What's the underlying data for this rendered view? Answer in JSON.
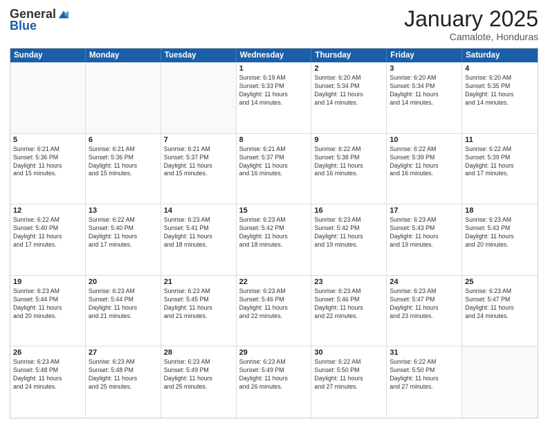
{
  "logo": {
    "general": "General",
    "blue": "Blue"
  },
  "title": "January 2025",
  "location": "Camalote, Honduras",
  "weekdays": [
    "Sunday",
    "Monday",
    "Tuesday",
    "Wednesday",
    "Thursday",
    "Friday",
    "Saturday"
  ],
  "weeks": [
    [
      {
        "day": "",
        "info": ""
      },
      {
        "day": "",
        "info": ""
      },
      {
        "day": "",
        "info": ""
      },
      {
        "day": "1",
        "info": "Sunrise: 6:19 AM\nSunset: 5:33 PM\nDaylight: 11 hours\nand 14 minutes."
      },
      {
        "day": "2",
        "info": "Sunrise: 6:20 AM\nSunset: 5:34 PM\nDaylight: 11 hours\nand 14 minutes."
      },
      {
        "day": "3",
        "info": "Sunrise: 6:20 AM\nSunset: 5:34 PM\nDaylight: 11 hours\nand 14 minutes."
      },
      {
        "day": "4",
        "info": "Sunrise: 6:20 AM\nSunset: 5:35 PM\nDaylight: 11 hours\nand 14 minutes."
      }
    ],
    [
      {
        "day": "5",
        "info": "Sunrise: 6:21 AM\nSunset: 5:36 PM\nDaylight: 11 hours\nand 15 minutes."
      },
      {
        "day": "6",
        "info": "Sunrise: 6:21 AM\nSunset: 5:36 PM\nDaylight: 11 hours\nand 15 minutes."
      },
      {
        "day": "7",
        "info": "Sunrise: 6:21 AM\nSunset: 5:37 PM\nDaylight: 11 hours\nand 15 minutes."
      },
      {
        "day": "8",
        "info": "Sunrise: 6:21 AM\nSunset: 5:37 PM\nDaylight: 11 hours\nand 16 minutes."
      },
      {
        "day": "9",
        "info": "Sunrise: 6:22 AM\nSunset: 5:38 PM\nDaylight: 11 hours\nand 16 minutes."
      },
      {
        "day": "10",
        "info": "Sunrise: 6:22 AM\nSunset: 5:39 PM\nDaylight: 11 hours\nand 16 minutes."
      },
      {
        "day": "11",
        "info": "Sunrise: 6:22 AM\nSunset: 5:39 PM\nDaylight: 11 hours\nand 17 minutes."
      }
    ],
    [
      {
        "day": "12",
        "info": "Sunrise: 6:22 AM\nSunset: 5:40 PM\nDaylight: 11 hours\nand 17 minutes."
      },
      {
        "day": "13",
        "info": "Sunrise: 6:22 AM\nSunset: 5:40 PM\nDaylight: 11 hours\nand 17 minutes."
      },
      {
        "day": "14",
        "info": "Sunrise: 6:23 AM\nSunset: 5:41 PM\nDaylight: 11 hours\nand 18 minutes."
      },
      {
        "day": "15",
        "info": "Sunrise: 6:23 AM\nSunset: 5:42 PM\nDaylight: 11 hours\nand 18 minutes."
      },
      {
        "day": "16",
        "info": "Sunrise: 6:23 AM\nSunset: 5:42 PM\nDaylight: 11 hours\nand 19 minutes."
      },
      {
        "day": "17",
        "info": "Sunrise: 6:23 AM\nSunset: 5:43 PM\nDaylight: 11 hours\nand 19 minutes."
      },
      {
        "day": "18",
        "info": "Sunrise: 6:23 AM\nSunset: 5:43 PM\nDaylight: 11 hours\nand 20 minutes."
      }
    ],
    [
      {
        "day": "19",
        "info": "Sunrise: 6:23 AM\nSunset: 5:44 PM\nDaylight: 11 hours\nand 20 minutes."
      },
      {
        "day": "20",
        "info": "Sunrise: 6:23 AM\nSunset: 5:44 PM\nDaylight: 11 hours\nand 21 minutes."
      },
      {
        "day": "21",
        "info": "Sunrise: 6:23 AM\nSunset: 5:45 PM\nDaylight: 11 hours\nand 21 minutes."
      },
      {
        "day": "22",
        "info": "Sunrise: 6:23 AM\nSunset: 5:46 PM\nDaylight: 11 hours\nand 22 minutes."
      },
      {
        "day": "23",
        "info": "Sunrise: 6:23 AM\nSunset: 5:46 PM\nDaylight: 11 hours\nand 22 minutes."
      },
      {
        "day": "24",
        "info": "Sunrise: 6:23 AM\nSunset: 5:47 PM\nDaylight: 11 hours\nand 23 minutes."
      },
      {
        "day": "25",
        "info": "Sunrise: 6:23 AM\nSunset: 5:47 PM\nDaylight: 11 hours\nand 24 minutes."
      }
    ],
    [
      {
        "day": "26",
        "info": "Sunrise: 6:23 AM\nSunset: 5:48 PM\nDaylight: 11 hours\nand 24 minutes."
      },
      {
        "day": "27",
        "info": "Sunrise: 6:23 AM\nSunset: 5:48 PM\nDaylight: 11 hours\nand 25 minutes."
      },
      {
        "day": "28",
        "info": "Sunrise: 6:23 AM\nSunset: 5:49 PM\nDaylight: 11 hours\nand 25 minutes."
      },
      {
        "day": "29",
        "info": "Sunrise: 6:23 AM\nSunset: 5:49 PM\nDaylight: 11 hours\nand 26 minutes."
      },
      {
        "day": "30",
        "info": "Sunrise: 6:22 AM\nSunset: 5:50 PM\nDaylight: 11 hours\nand 27 minutes."
      },
      {
        "day": "31",
        "info": "Sunrise: 6:22 AM\nSunset: 5:50 PM\nDaylight: 11 hours\nand 27 minutes."
      },
      {
        "day": "",
        "info": ""
      }
    ]
  ]
}
